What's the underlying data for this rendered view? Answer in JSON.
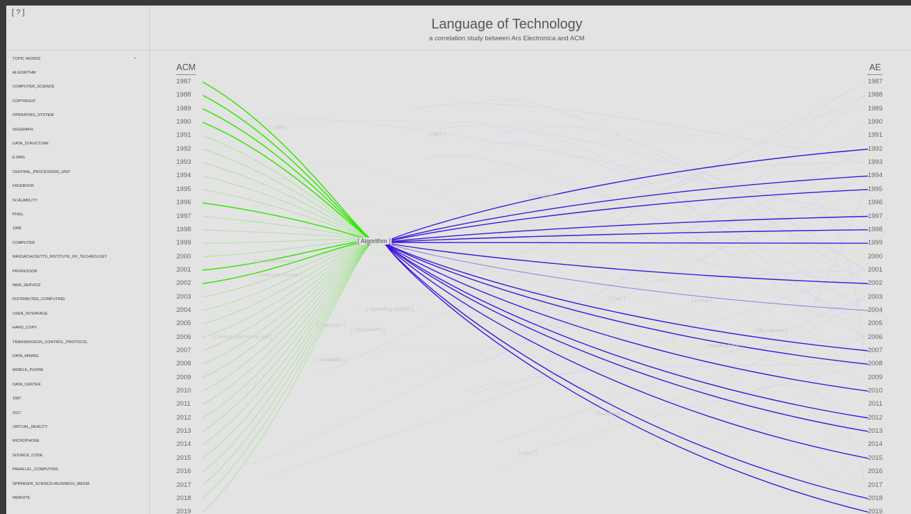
{
  "help": {
    "label": "[ ? ]"
  },
  "header": {
    "title": "Language of Technology",
    "subtitle": "a correlation study between Ars Electronica and ACM"
  },
  "sidebar": {
    "header": "TOPIC WORDS",
    "caret": "-",
    "items": [
      "ALGORITHM",
      "COMPUTER_SCIENCE",
      "COPYRIGHT",
      "OPERATING_SYSTEM",
      "SIGGRAPH",
      "DATA_STRUCTURE",
      "E-MAIL",
      "CENTRAL_PROCESSING_UNIT",
      "FACEBOOK",
      "SCALABILITY",
      "PIXEL",
      "1988",
      "COMPUTER",
      "MASSACHUSETTS_INSTITUTE_OF_TECHNOLOGY",
      "PROFESSOR",
      "WEB_SERVICE",
      "DISTRIBUTED_COMPUTING",
      "USER_INTERFACE",
      "HARD_COPY",
      "TRANSMISSION_CONTROL_PROTOCOL",
      "DATA_MINING",
      "MOBILE_PHONE",
      "DATA_CENTER",
      "1987",
      "2017",
      "VIRTUAL_REALITY",
      "MICROPHONE",
      "SOURCE_CODE",
      "PARALLEL_COMPUTING",
      "SPRINGER_SCIENCE+BUSINESS_MEDIA",
      "WEBSITE"
    ]
  },
  "viz": {
    "left_axis_title": "ACM",
    "right_axis_title": "AE",
    "years": [
      "1987",
      "1988",
      "1989",
      "1990",
      "1991",
      "1992",
      "1993",
      "1994",
      "1995",
      "1996",
      "1997",
      "1998",
      "1999",
      "2000",
      "2001",
      "2002",
      "2003",
      "2004",
      "2005",
      "2006",
      "2007",
      "2008",
      "2009",
      "2010",
      "2011",
      "2012",
      "2013",
      "2014",
      "2015",
      "2016",
      "2017",
      "2018",
      "2019"
    ],
    "focus_label": "[ Algorithm ]",
    "acm_color": "#33e600",
    "ae_color": "#3d14e0",
    "acm_strong_years": [
      "1987",
      "1988",
      "1989",
      "1990",
      "1996",
      "2001",
      "2002"
    ],
    "acm_faint_years": [
      "1991",
      "1992",
      "1993",
      "1994",
      "1995",
      "1997",
      "1998",
      "1999",
      "2000",
      "2003",
      "2004",
      "2005",
      "2006",
      "2007",
      "2008",
      "2009",
      "2010",
      "2011",
      "2012",
      "2013",
      "2014",
      "2015",
      "2016",
      "2017",
      "2018",
      "2019"
    ],
    "ae_strong_years": [
      "1992",
      "1994",
      "1995",
      "1997",
      "1998",
      "1999",
      "2002",
      "2007",
      "2008",
      "2010",
      "2012",
      "2013",
      "2015",
      "2018",
      "2019"
    ],
    "ae_faint_years": [
      "2004"
    ],
    "background_labels": [
      "[ 1988 ]",
      "[ 1987 ]",
      "[ Computer ]",
      "[ Computer science ]",
      "[ Operating system ]",
      "[ Copyright ]",
      "[ SIGGRAPH ]",
      "[ Central processing unit ]",
      "[ Scalability ]",
      "[ Facebook ]",
      "[ 2017 ]",
      "[ Pixel ]",
      "[ E-mail ]",
      "[ Mobile phone ]",
      "[ Microphone ]",
      "[ Data structure ]"
    ]
  }
}
